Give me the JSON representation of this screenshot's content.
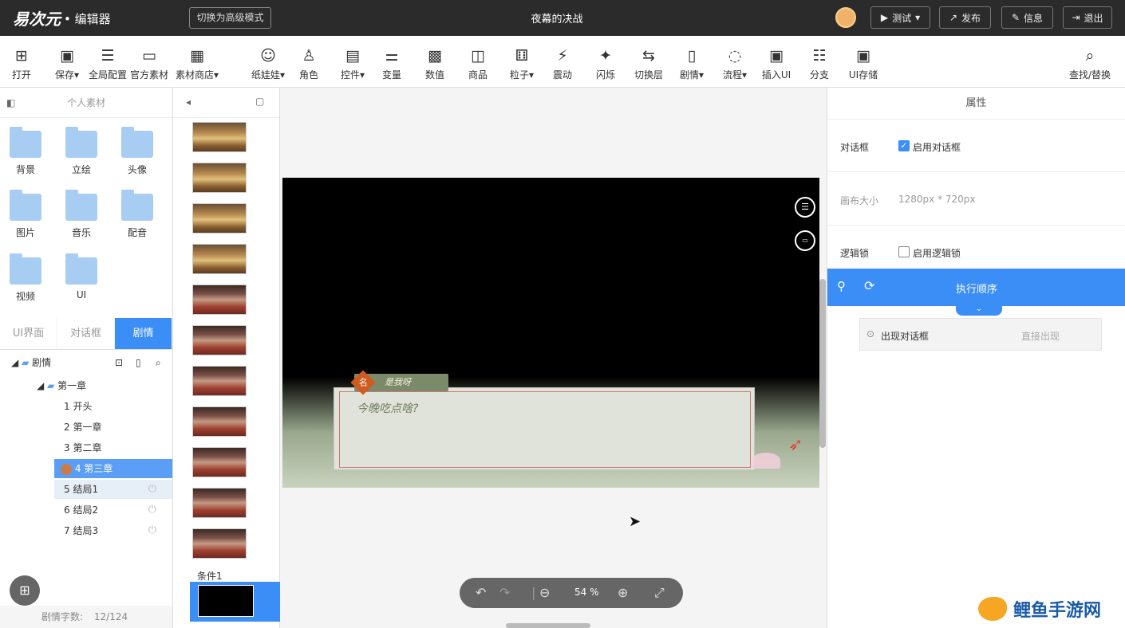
{
  "topbar": {
    "logo": "易次元",
    "app_name": "• 编辑器",
    "mode_button": "切换为高级模式",
    "project_title": "夜幕的决战",
    "buttons": {
      "test": "测试",
      "publish": "发布",
      "info": "信息",
      "exit": "退出"
    }
  },
  "toolbar": {
    "items": [
      {
        "label": "打开",
        "icon": "plus-square-icon"
      },
      {
        "label": "保存▾",
        "icon": "save-icon"
      },
      {
        "label": "全局配置",
        "icon": "list-icon"
      },
      {
        "label": "官方素材",
        "icon": "folder-icon"
      },
      {
        "label": "素材商店▾",
        "icon": "store-icon"
      },
      {
        "label": "纸娃娃▾",
        "icon": "doll-icon"
      },
      {
        "label": "角色",
        "icon": "person-icon"
      },
      {
        "label": "控件▾",
        "icon": "widget-icon"
      },
      {
        "label": "变量",
        "icon": "variable-icon"
      },
      {
        "label": "数值",
        "icon": "number-icon"
      },
      {
        "label": "商品",
        "icon": "bag-icon"
      },
      {
        "label": "粒子▾",
        "icon": "dice-icon"
      },
      {
        "label": "震动",
        "icon": "shake-icon"
      },
      {
        "label": "闪烁",
        "icon": "flash-icon"
      },
      {
        "label": "切换层",
        "icon": "layer-switch-icon"
      },
      {
        "label": "剧情▾",
        "icon": "document-icon"
      },
      {
        "label": "流程▾",
        "icon": "process-icon"
      },
      {
        "label": "插入UI",
        "icon": "insert-ui-icon"
      },
      {
        "label": "分支",
        "icon": "branch-icon"
      },
      {
        "label": "UI存储",
        "icon": "ui-storage-icon"
      },
      {
        "label": "查找/替换",
        "icon": "find-replace-icon"
      }
    ]
  },
  "left_panel": {
    "header": "个人素材",
    "folders": [
      "背景",
      "立绘",
      "头像",
      "图片",
      "音乐",
      "配音",
      "视频",
      "UI"
    ],
    "tabs": [
      {
        "label": "UI界面",
        "active": false
      },
      {
        "label": "对话框",
        "active": false
      },
      {
        "label": "剧情",
        "active": true
      }
    ],
    "tree": {
      "root": "剧情",
      "chapter": "第一章",
      "items": [
        {
          "label": "1  开头"
        },
        {
          "label": "2  第一章"
        },
        {
          "label": "3  第二章"
        },
        {
          "label": "4  第三章"
        },
        {
          "label": "5  结局1"
        },
        {
          "label": "6  结局2"
        },
        {
          "label": "7  结局3"
        }
      ]
    },
    "word_count_label": "剧情字数:",
    "word_count_value": "12/124"
  },
  "thumbs": {
    "condition_label": "条件1"
  },
  "stage": {
    "speaker_tag_icon": "名",
    "speaker": "是我呀",
    "dialog": "今晚吃点啥?"
  },
  "zoom": {
    "value": "54 %"
  },
  "right_panel": {
    "header": "属性",
    "dialog_box_label": "对话框",
    "dialog_box_checkbox": "启用对话框",
    "dialog_box_enabled": true,
    "canvas_size_label": "画布大小",
    "canvas_size_value": "1280px * 720px",
    "logic_lock_label": "逻辑锁",
    "logic_lock_checkbox": "启用逻辑锁",
    "logic_lock_enabled": false,
    "exec_order_title": "执行顺序",
    "exec_item_label": "出现对话框",
    "exec_item_mode": "直接出现"
  },
  "watermark": {
    "text": "鲤鱼手游网"
  },
  "colors": {
    "accent": "#3a8ef5",
    "topbar": "#2b2b2b"
  }
}
